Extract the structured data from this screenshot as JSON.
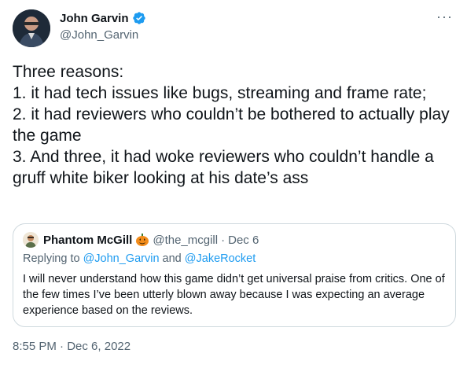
{
  "author": {
    "name": "John Garvin",
    "handle": "@John_Garvin",
    "verified": true
  },
  "tweet": {
    "text": "Three reasons:\n1. it had tech issues like bugs, streaming and frame rate;\n2. it had reviewers who couldn’t be bothered to actually play the game\n3. And three, it had woke reviewers who couldn’t handle a gruff white biker looking at his date’s ass",
    "more_icon": "more-horizontal-icon"
  },
  "quote": {
    "author_name": "Phantom McGill",
    "author_emoji": "jack-o-lantern-icon",
    "handle": "@the_mcgill",
    "separator": "·",
    "date": "Dec 6",
    "replying_prefix": "Replying to",
    "mention_1": "@John_Garvin",
    "conjunction": "and",
    "mention_2": "@JakeRocket",
    "text": "I will never understand how this game didn’t get universal praise from critics. One of the few times I’ve been utterly blown away because I was expecting an average experience based on the reviews."
  },
  "timestamp": {
    "time": "8:55 PM",
    "separator": "·",
    "date": "Dec 6, 2022"
  },
  "colors": {
    "text": "#0f1419",
    "secondary": "#536471",
    "link": "#1d9bf0",
    "border": "#cfd9de",
    "verified": "#1d9bf0"
  }
}
